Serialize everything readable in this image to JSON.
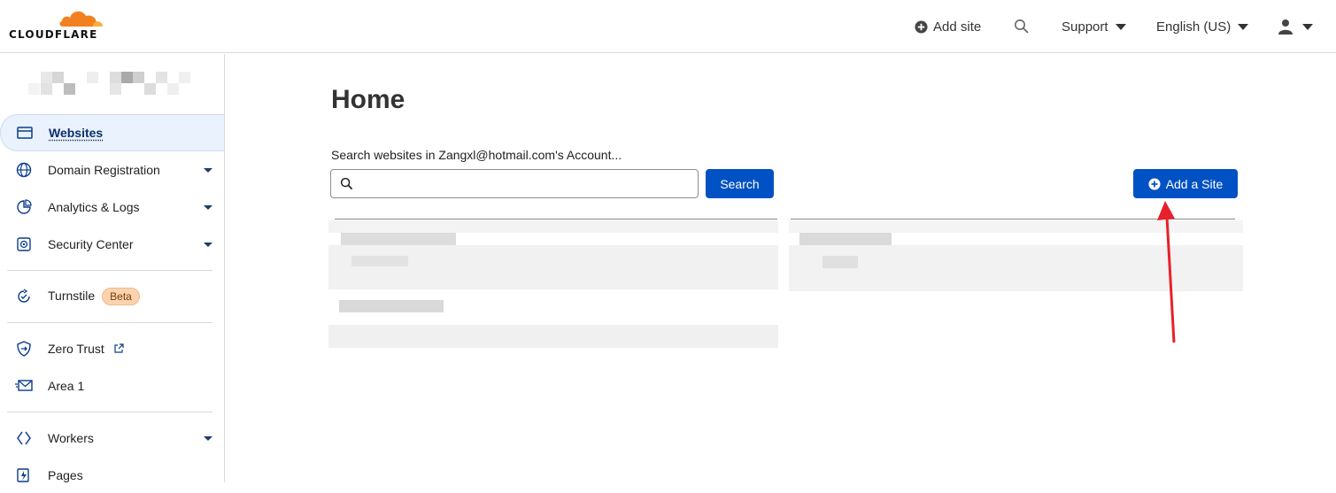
{
  "brand": {
    "name": "CLOUDFLARE",
    "accent": "#f38020",
    "primary_blue": "#0051c3"
  },
  "topnav": {
    "add_site": "Add site",
    "support": "Support",
    "language": "English (US)"
  },
  "sidebar": {
    "items": [
      {
        "label": "Websites",
        "icon": "browser-window-icon",
        "active": true
      },
      {
        "label": "Domain Registration",
        "icon": "globe-icon",
        "dropdown": true
      },
      {
        "label": "Analytics & Logs",
        "icon": "pie-chart-icon",
        "dropdown": true
      },
      {
        "label": "Security Center",
        "icon": "shield-target-icon",
        "dropdown": true
      },
      {
        "label": "Turnstile",
        "icon": "turnstile-icon",
        "badge": "Beta"
      },
      {
        "label": "Zero Trust",
        "icon": "shield-icon",
        "external": true
      },
      {
        "label": "Area 1",
        "icon": "mail-icon"
      },
      {
        "label": "Workers",
        "icon": "workers-icon",
        "dropdown": true
      },
      {
        "label": "Pages",
        "icon": "pages-icon"
      }
    ]
  },
  "main": {
    "title": "Home",
    "search_label": "Search websites in Zangxl@hotmail.com's Account...",
    "search_value": "",
    "search_button": "Search",
    "add_site_button": "Add a Site"
  }
}
